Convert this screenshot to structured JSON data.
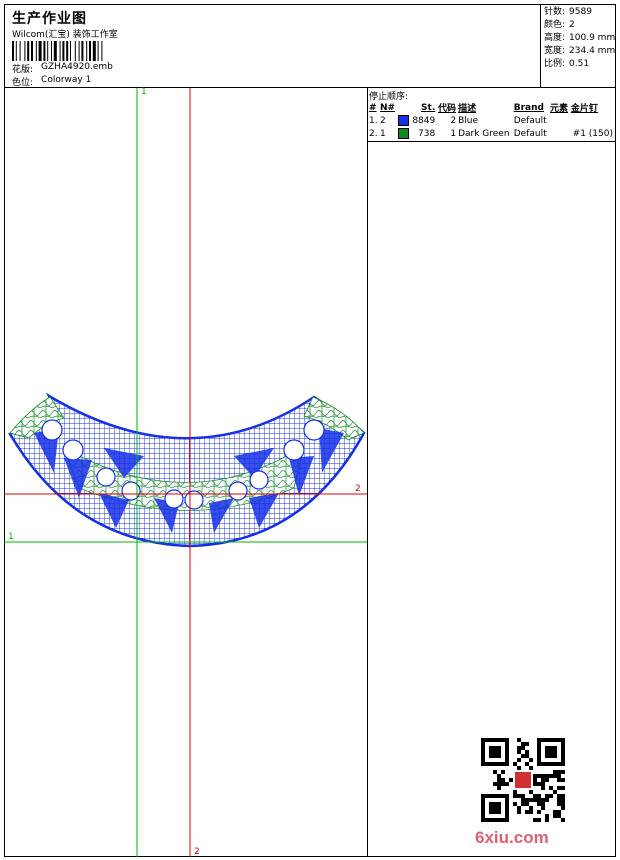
{
  "header": {
    "title": "生产作业图",
    "software": "Wilcom(汇宝) 装饰工作室",
    "design_label": "花版:",
    "design_file": "GZHA4920.emb",
    "colorway_label": "色位:",
    "colorway": "Colorway 1"
  },
  "stats": {
    "stitches_label": "针数:",
    "stitches": "9589",
    "colors_label": "颜色:",
    "colors": "2",
    "height_label": "高度:",
    "height": "100.9 mm",
    "width_label": "宽度:",
    "width": "234.4 mm",
    "scale_label": "比例:",
    "scale": "0.51"
  },
  "stop_sequence": {
    "title": "停止顺序:",
    "columns": [
      "#",
      "N#",
      "St.",
      "代码",
      "描述",
      "Brand",
      "元素",
      "金片钉"
    ],
    "rows": [
      {
        "index": "1.",
        "needle": "2",
        "color": "#1530e8",
        "stitches": "8849",
        "code": "2",
        "description": "Blue",
        "brand": "Default",
        "elements": "",
        "sequin": ""
      },
      {
        "index": "2.",
        "needle": "1",
        "color": "#0e8a1e",
        "stitches": "738",
        "code": "1",
        "description": "Dark Green",
        "brand": "Default",
        "elements": "",
        "sequin": "#1 (150)"
      }
    ]
  },
  "design": {
    "axis_labels": {
      "green_vertical": "1",
      "red_vertical": "2",
      "red_horizontal": "2",
      "green_horizontal": "1"
    },
    "colors": {
      "primary": "#1530e8",
      "secondary": "#0e8a1e",
      "guide_red": "#e00000",
      "guide_green": "#00b400"
    }
  },
  "watermark": {
    "text": "6xiu.com"
  }
}
